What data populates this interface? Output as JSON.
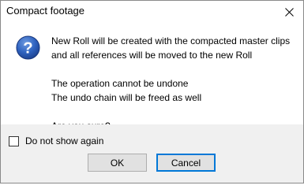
{
  "window": {
    "title": "Compact footage"
  },
  "icons": {
    "close": "close-icon",
    "question": "question-icon"
  },
  "message": {
    "line1": "New Roll will be created with the compacted master clips",
    "line2": "and all references will be moved to the new Roll",
    "line3": "The operation cannot be undone",
    "line4": "The undo chain will be freed as well",
    "line5": "Are you sure?"
  },
  "options": {
    "do_not_show_label": "Do not show again",
    "do_not_show_checked": false
  },
  "buttons": {
    "ok_label": "OK",
    "cancel_label": "Cancel"
  },
  "colors": {
    "accent": "#0078d7",
    "icon_fill": "#1f4e9c",
    "footer_bg": "#f0f0f0"
  }
}
